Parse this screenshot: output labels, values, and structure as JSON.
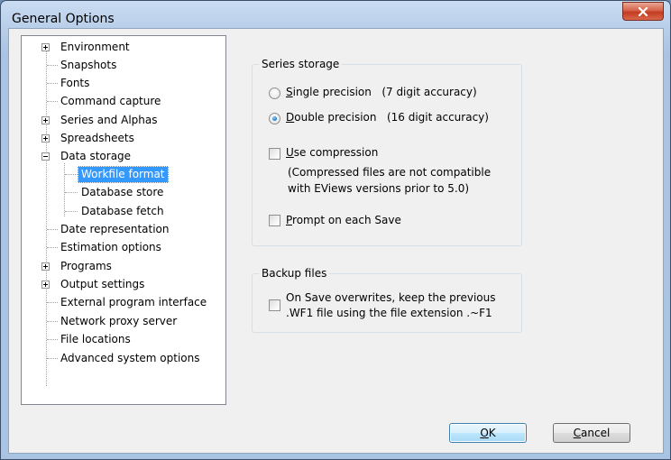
{
  "window": {
    "title": "General Options"
  },
  "tree": {
    "items": [
      {
        "label": "Environment",
        "expander": "+"
      },
      {
        "label": "Snapshots"
      },
      {
        "label": "Fonts"
      },
      {
        "label": "Command capture"
      },
      {
        "label": "Series and Alphas",
        "expander": "+"
      },
      {
        "label": "Spreadsheets",
        "expander": "+"
      },
      {
        "label": "Data storage",
        "expander": "-"
      },
      {
        "label": "Workfile format",
        "selected": true,
        "child": true
      },
      {
        "label": "Database store",
        "child": true
      },
      {
        "label": "Database fetch",
        "child": true
      },
      {
        "label": "Date representation"
      },
      {
        "label": "Estimation options"
      },
      {
        "label": "Programs",
        "expander": "+"
      },
      {
        "label": "Output settings",
        "expander": "+"
      },
      {
        "label": "External program interface"
      },
      {
        "label": "Network proxy server"
      },
      {
        "label": "File locations"
      },
      {
        "label": "Advanced system options"
      }
    ]
  },
  "series_storage": {
    "title": "Series storage",
    "single": {
      "u": "S",
      "rest": "ingle precision",
      "detail": "(7 digit accuracy)",
      "checked": false
    },
    "double": {
      "u": "D",
      "rest": "ouble precision",
      "detail": "(16 digit accuracy)",
      "checked": true
    },
    "compression": {
      "u": "U",
      "rest": "se compression",
      "checked": false
    },
    "compression_note_1": "(Compressed files are not compatible",
    "compression_note_2": "with EViews versions prior to 5.0)",
    "prompt": {
      "u": "P",
      "rest": "rompt on each Save",
      "checked": false
    }
  },
  "backup": {
    "title": "Backup files",
    "line1": "On Save overwrites, keep the previous",
    "line2": ".WF1 file using the file extension .~F1",
    "checked": false
  },
  "buttons": {
    "ok": {
      "u": "O",
      "rest": "K"
    },
    "cancel": {
      "u": "C",
      "rest": "ancel"
    }
  },
  "colors": {
    "selection": "#3399ff",
    "close_button": "#c94a30"
  },
  "icons": [
    "close-icon",
    "expand-icon",
    "collapse-icon"
  ]
}
